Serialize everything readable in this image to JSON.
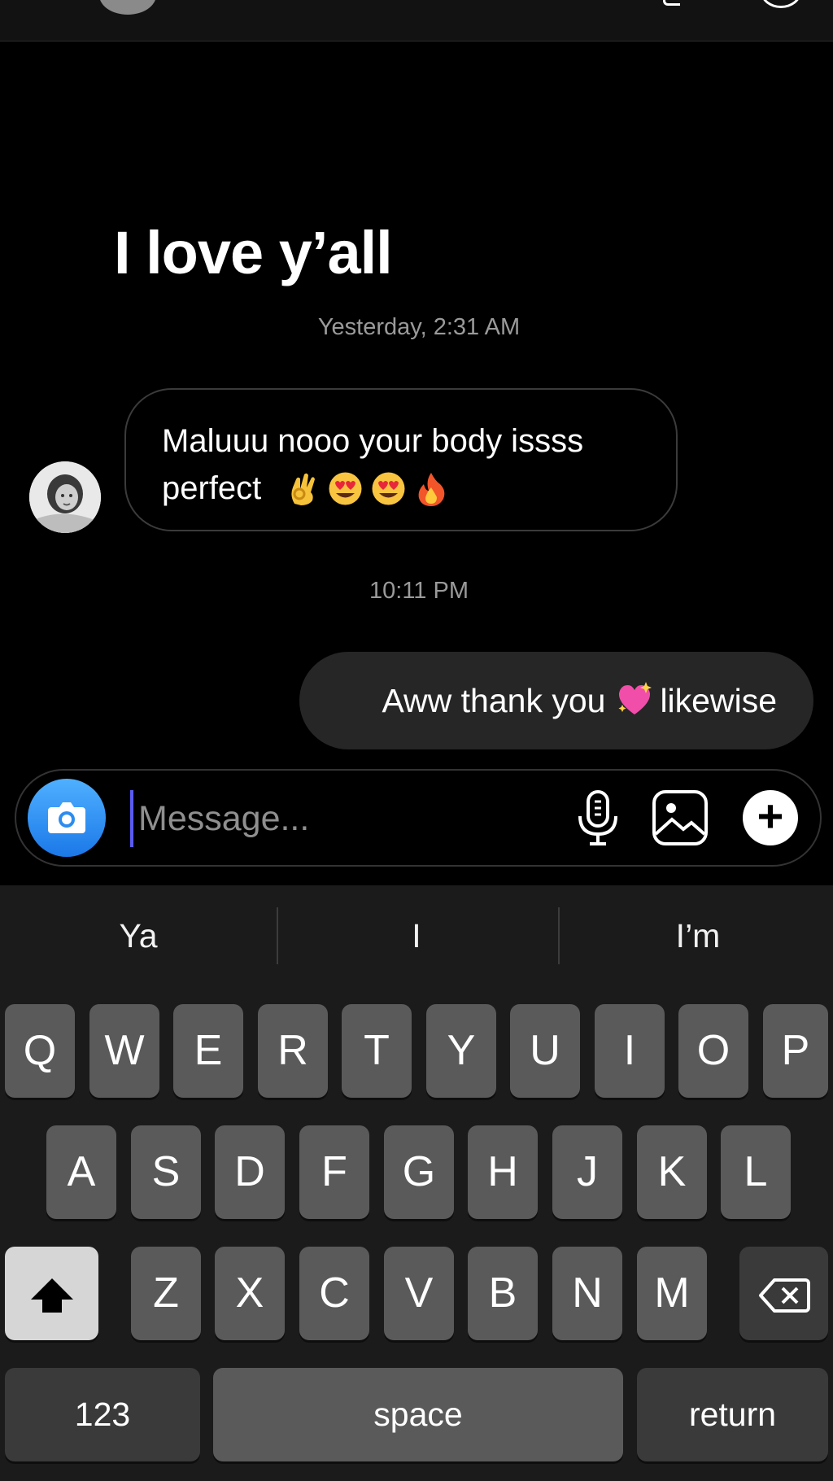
{
  "header": {
    "avatar": "avatar",
    "icons": [
      "phone-icon",
      "video-icon"
    ]
  },
  "thread": {
    "shared_text": "I love y’all",
    "timestamp_1": "Yesterday, 2:31 AM",
    "incoming": {
      "line1": "Maluuu nooo your body issss",
      "line2": "perfect",
      "emojis": [
        "ok-hand-emoji",
        "heart-eyes-emoji",
        "heart-eyes-emoji",
        "fire-emoji"
      ]
    },
    "timestamp_2": "10:11 PM",
    "outgoing": {
      "part1": "Aww thank you",
      "emoji": "sparkling-heart-emoji",
      "part2": "likewise"
    }
  },
  "composer": {
    "placeholder": "Message...",
    "icons": [
      "camera-icon",
      "microphone-icon",
      "gallery-icon",
      "plus-icon"
    ]
  },
  "keyboard": {
    "suggestions": [
      "Ya",
      "I",
      "I’m"
    ],
    "row1": [
      "Q",
      "W",
      "E",
      "R",
      "T",
      "Y",
      "U",
      "I",
      "O",
      "P"
    ],
    "row2": [
      "A",
      "S",
      "D",
      "F",
      "G",
      "H",
      "J",
      "K",
      "L"
    ],
    "row3": [
      "Z",
      "X",
      "C",
      "V",
      "B",
      "N",
      "M"
    ],
    "numbers_label": "123",
    "space_label": "space",
    "return_label": "return",
    "shift_icon": "shift-icon",
    "delete_icon": "delete-icon"
  },
  "colors": {
    "background": "#000000",
    "bubble_outgoing": "#262626",
    "camera_button": "#1b78e8",
    "keyboard": "#1b1b1b",
    "key": "#5a5a5a"
  }
}
